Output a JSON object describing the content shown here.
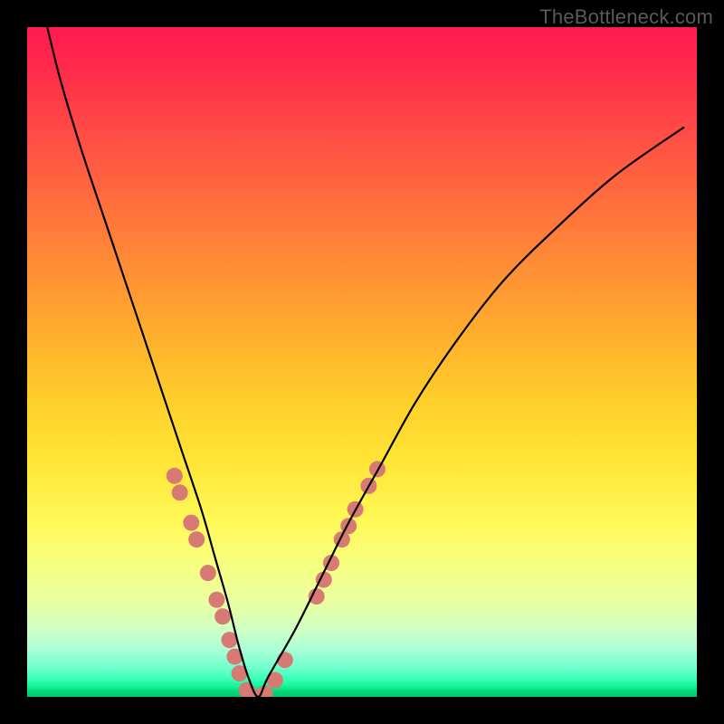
{
  "watermark": "TheBottleneck.com",
  "chart_data": {
    "type": "line",
    "title": "",
    "xlabel": "",
    "ylabel": "",
    "xlim": [
      0,
      100
    ],
    "ylim": [
      0,
      100
    ],
    "grid": false,
    "gradient_stops": [
      {
        "pct": 0,
        "color": "#ff1a4f"
      },
      {
        "pct": 15,
        "color": "#ff4946"
      },
      {
        "pct": 35,
        "color": "#ff8b36"
      },
      {
        "pct": 56,
        "color": "#ffcf2a"
      },
      {
        "pct": 74,
        "color": "#fff95a"
      },
      {
        "pct": 90,
        "color": "#cfffc4"
      },
      {
        "pct": 97,
        "color": "#3fffb9"
      },
      {
        "pct": 100,
        "color": "#02c768"
      }
    ],
    "series": [
      {
        "name": "bottleneck-curve",
        "color": "#000000",
        "x": [
          3,
          5,
          8,
          12,
          16,
          20,
          23,
          26,
          28,
          30,
          31.5,
          33,
          34.5,
          36,
          40,
          44,
          48,
          53,
          58,
          64,
          71,
          79,
          88,
          98
        ],
        "y": [
          100,
          92,
          82,
          70,
          58,
          46,
          37,
          28,
          21,
          14,
          8,
          3,
          0,
          3,
          10,
          18,
          26,
          35,
          44,
          53,
          62,
          70,
          78,
          85
        ]
      }
    ],
    "markers": {
      "name": "highlight-dots",
      "color": "#d87a74",
      "radius_px": 9,
      "points": [
        {
          "x": 22.0,
          "y": 33.0
        },
        {
          "x": 22.8,
          "y": 30.5
        },
        {
          "x": 24.5,
          "y": 26.0
        },
        {
          "x": 25.3,
          "y": 23.5
        },
        {
          "x": 27.0,
          "y": 18.5
        },
        {
          "x": 28.3,
          "y": 14.5
        },
        {
          "x": 29.2,
          "y": 12.0
        },
        {
          "x": 30.2,
          "y": 8.5
        },
        {
          "x": 31.0,
          "y": 6.0
        },
        {
          "x": 31.7,
          "y": 3.5
        },
        {
          "x": 32.8,
          "y": 1.0
        },
        {
          "x": 34.0,
          "y": 0.0
        },
        {
          "x": 35.5,
          "y": 0.5
        },
        {
          "x": 37.0,
          "y": 2.5
        },
        {
          "x": 38.5,
          "y": 5.5
        },
        {
          "x": 43.2,
          "y": 15.0
        },
        {
          "x": 44.3,
          "y": 17.5
        },
        {
          "x": 45.4,
          "y": 20.0
        },
        {
          "x": 47.0,
          "y": 23.5
        },
        {
          "x": 48.0,
          "y": 25.5
        },
        {
          "x": 49.0,
          "y": 28.0
        },
        {
          "x": 51.0,
          "y": 31.5
        },
        {
          "x": 52.3,
          "y": 34.0
        }
      ]
    }
  }
}
